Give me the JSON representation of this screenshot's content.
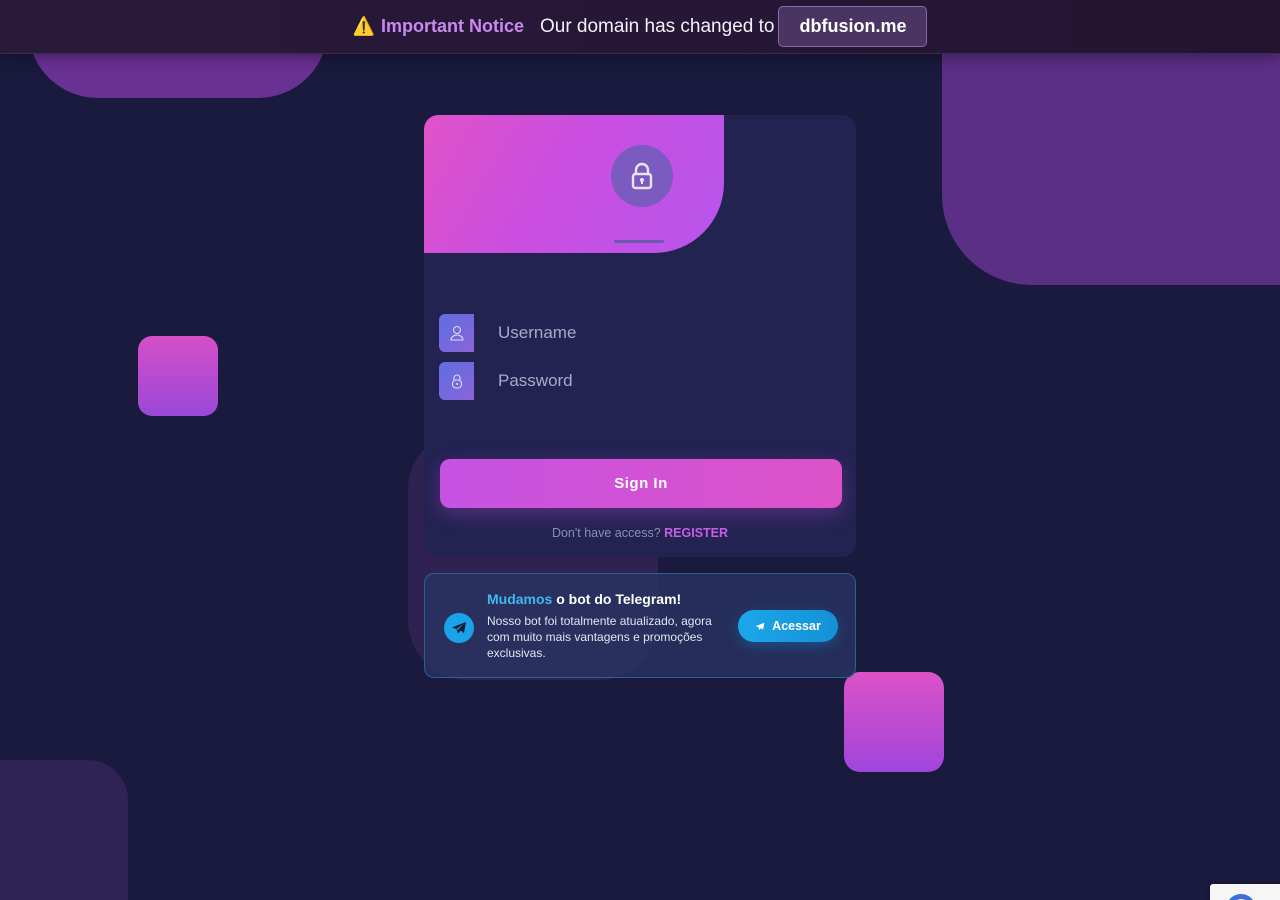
{
  "notice": {
    "icon": "⚠️",
    "title": "Important Notice",
    "text": "Our domain has changed to",
    "domain": "dbfusion.me"
  },
  "login": {
    "lock_icon": "lock-icon",
    "username_placeholder": "Username",
    "password_placeholder": "Password",
    "signin_label": "Sign In",
    "register_prompt": "Don't have access?",
    "register_label": "REGISTER"
  },
  "telegram": {
    "title_highlight": "Mudamos",
    "title_rest": "o bot do Telegram!",
    "description": "Nosso bot foi totalmente atualizado, agora com muito mais vantagens e promoções exclusivas.",
    "button_label": "Acessar"
  },
  "colors": {
    "background": "#1a1a3e",
    "accent_pink": "#dd52c8",
    "accent_purple": "#c553e2",
    "telegram_blue": "#1aa3e8"
  }
}
